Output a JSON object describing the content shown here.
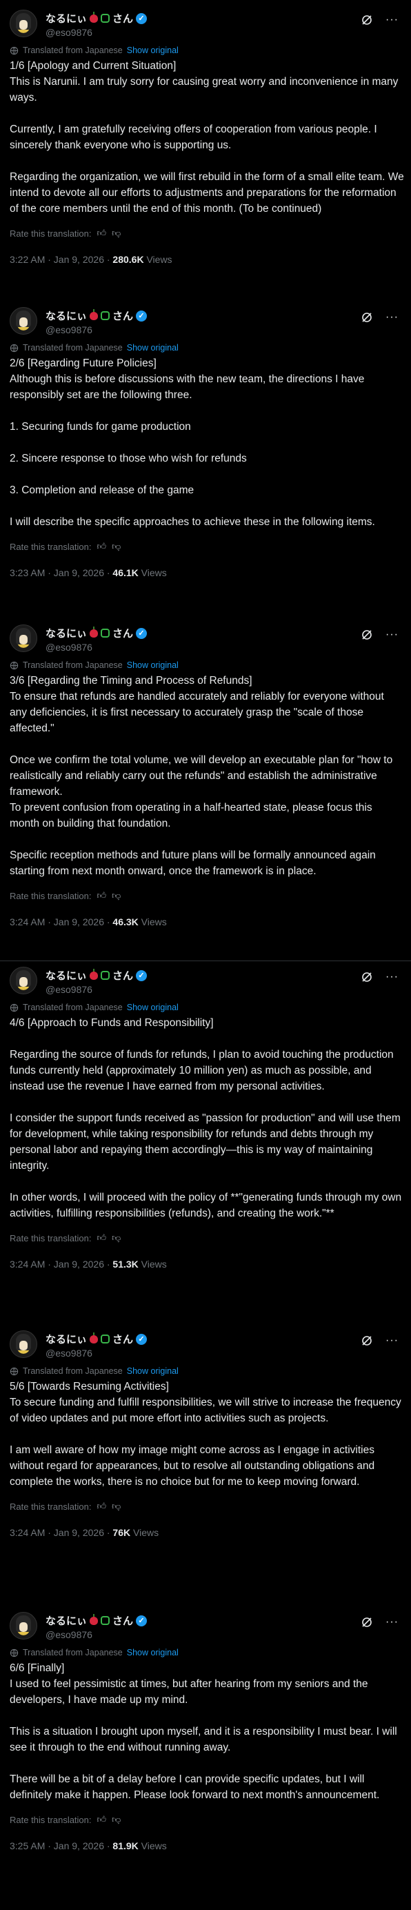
{
  "author": {
    "display_name": "なるにぃ",
    "display_suffix": "さん",
    "handle": "@eso9876"
  },
  "translation": {
    "translated_label": "Translated from Japanese",
    "show_original": "Show original",
    "rate_label": "Rate this translation:"
  },
  "icons": {
    "verified": "verified-badge-icon",
    "grok": "grok-icon",
    "more": "more-icon",
    "globe": "globe-icon",
    "thumb_up": "thumbs-up-icon",
    "thumb_down": "thumbs-down-icon"
  },
  "colors": {
    "accent": "#1d9bf0",
    "background": "#000000",
    "text": "#e7e9ea",
    "muted": "#71767b"
  },
  "tweets": [
    {
      "body": "1/6 [Apology and Current Situation]\nThis is Narunii. I am truly sorry for causing great worry and inconvenience in many ways.\n\nCurrently, I am gratefully receiving offers of cooperation from various people. I sincerely thank everyone who is supporting us.\n\nRegarding the organization, we will first rebuild in the form of a small elite team. We intend to devote all our efforts to adjustments and preparations for the reformation of the core members until the end of this month. (To be continued)",
      "time": "3:22 AM · Jan 9, 2026 · ",
      "views_count": "280.6K",
      "views_label": " Views"
    },
    {
      "body": "2/6 [Regarding Future Policies]\nAlthough this is before discussions with the new team, the directions I have responsibly set are the following three.\n\n1. Securing funds for game production\n\n2. Sincere response to those who wish for refunds\n\n3. Completion and release of the game\n\nI will describe the specific approaches to achieve these in the following items.",
      "time": "3:23 AM · Jan 9, 2026 · ",
      "views_count": "46.1K",
      "views_label": " Views"
    },
    {
      "body": "3/6 [Regarding the Timing and Process of Refunds]\nTo ensure that refunds are handled accurately and reliably for everyone without any deficiencies, it is first necessary to accurately grasp the \"scale of those affected.\"\n\nOnce we confirm the total volume, we will develop an executable plan for \"how to realistically and reliably carry out the refunds\" and establish the administrative framework.\nTo prevent confusion from operating in a half-hearted state, please focus this month on building that foundation.\n\nSpecific reception methods and future plans will be formally announced again starting from next month onward, once the framework is in place.",
      "time": "3:24 AM · Jan 9, 2026 · ",
      "views_count": "46.3K",
      "views_label": " Views"
    },
    {
      "body": "4/6 [Approach to Funds and Responsibility]\n\nRegarding the source of funds for refunds, I plan to avoid touching the production funds currently held (approximately 10 million yen) as much as possible, and instead use the revenue I have earned from my personal activities.\n\nI consider the support funds received as \"passion for production\" and will use them for development, while taking responsibility for refunds and debts through my personal labor and repaying them accordingly—this is my way of maintaining integrity.\n\nIn other words, I will proceed with the policy of **\"generating funds through my own activities, fulfilling responsibilities (refunds), and creating the work.\"**",
      "time": "3:24 AM · Jan 9, 2026 · ",
      "views_count": "51.3K",
      "views_label": " Views"
    },
    {
      "body": "5/6 [Towards Resuming Activities]\nTo secure funding and fulfill responsibilities, we will strive to increase the frequency of video updates and put more effort into activities such as projects.\n\nI am well aware of how my image might come across as I engage in activities without regard for appearances, but to resolve all outstanding obligations and complete the works, there is no choice but for me to keep moving forward.",
      "time": "3:24 AM · Jan 9, 2026 · ",
      "views_count": "76K",
      "views_label": " Views"
    },
    {
      "body": "6/6 [Finally]\nI used to feel pessimistic at times, but after hearing from my seniors and the developers, I have made up my mind.\n\nThis is a situation I brought upon myself, and it is a responsibility I must bear. I will see it through to the end without running away.\n\nThere will be a bit of a delay before I can provide specific updates, but I will definitely make it happen. Please look forward to next month's announcement.",
      "time": "3:25 AM · Jan 9, 2026 · ",
      "views_count": "81.9K",
      "views_label": " Views"
    }
  ]
}
